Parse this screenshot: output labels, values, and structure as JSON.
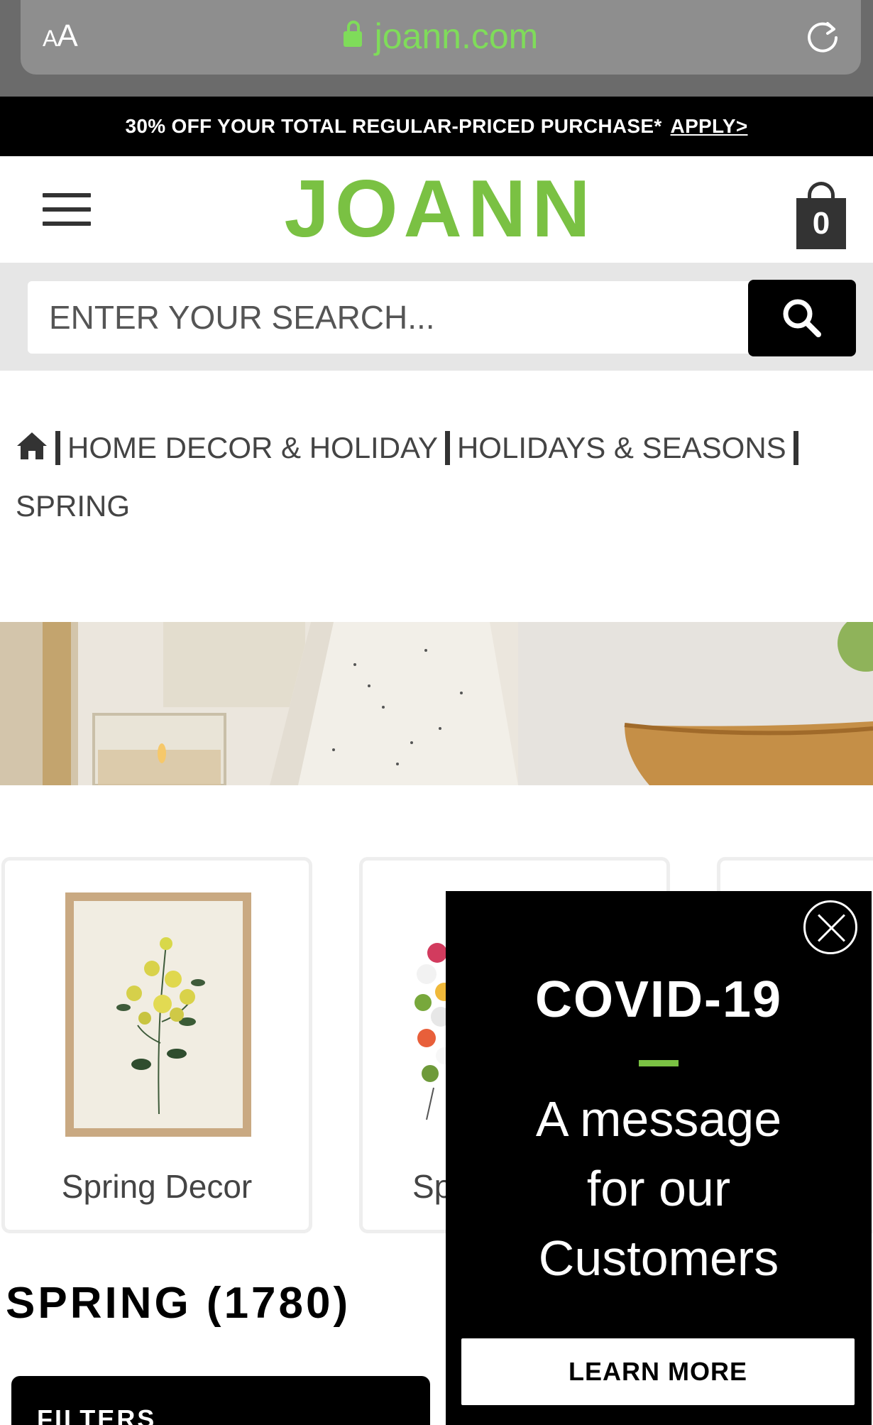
{
  "browser": {
    "text_size_label_small": "A",
    "text_size_label_large": "A",
    "url": "joann.com"
  },
  "promo": {
    "text": "30% OFF YOUR TOTAL REGULAR-PRICED PURCHASE*",
    "link": "APPLY>"
  },
  "header": {
    "logo": "JOANN",
    "cart_count": "0"
  },
  "search": {
    "placeholder": "ENTER YOUR SEARCH..."
  },
  "breadcrumb": {
    "items": [
      "HOME DECOR & HOLIDAY",
      "HOLIDAYS & SEASONS",
      "SPRING"
    ]
  },
  "categories": [
    {
      "label": "Spring Decor"
    },
    {
      "label": "Sp"
    }
  ],
  "section": {
    "title": "SPRING (1780)",
    "filters_label": "FILTERS"
  },
  "modal": {
    "title": "COVID-19",
    "message_line1": "A message",
    "message_line2": "for our",
    "message_line3": "Customers",
    "button": "LEARN MORE"
  },
  "colors": {
    "brand_green": "#7ac143",
    "url_green": "#7fdc5a"
  }
}
